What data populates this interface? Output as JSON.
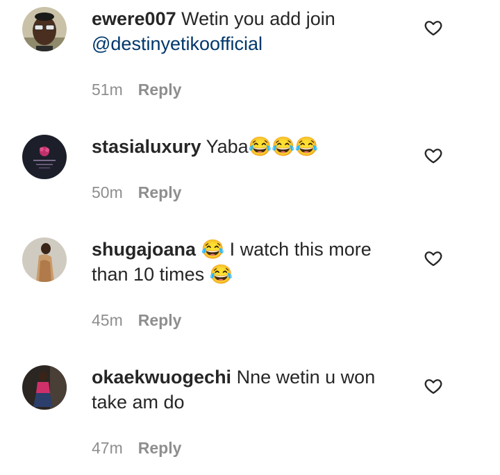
{
  "comments": [
    {
      "username": "ewere007",
      "text": "Wetin you add join",
      "mention": "@destinyetikoofficial",
      "time": "51m",
      "reply_label": "Reply",
      "avatar_icon": "profile-photo"
    },
    {
      "username": "stasialuxury",
      "text": "Yaba😂😂😂",
      "time": "50m",
      "reply_label": "Reply",
      "avatar_icon": "profile-photo"
    },
    {
      "username": "shugajoana",
      "text": "😂 I watch this more than 10 times 😂",
      "time": "45m",
      "reply_label": "Reply",
      "avatar_icon": "profile-photo"
    },
    {
      "username": "okaekwuogechi",
      "text": "Nne wetin u won take am do",
      "time": "47m",
      "reply_label": "Reply",
      "avatar_icon": "profile-photo"
    }
  ],
  "like_icon": "heart-outline-icon",
  "colors": {
    "text": "#262626",
    "mention": "#00376b",
    "meta": "#8e8e8e",
    "background": "#ffffff"
  }
}
